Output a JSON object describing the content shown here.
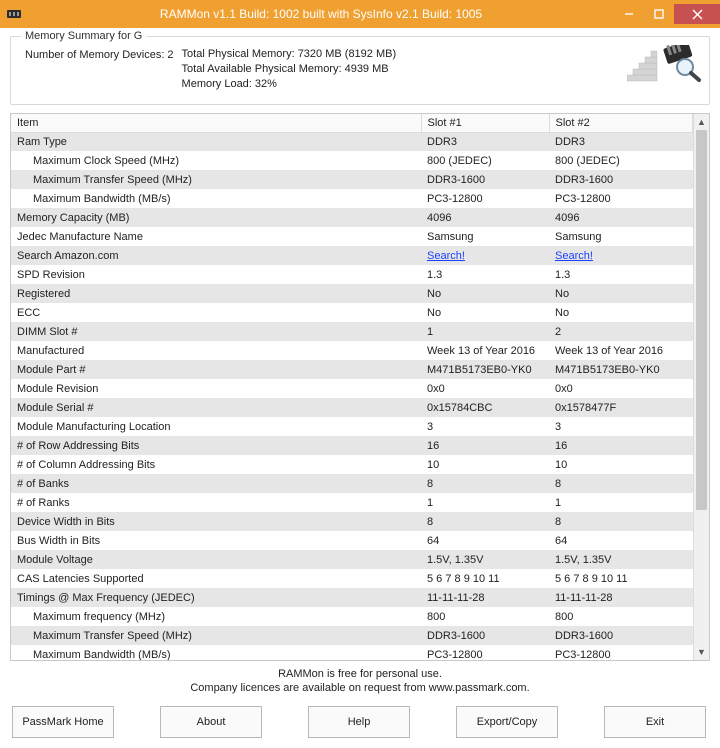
{
  "titlebar": {
    "title": "RAMMon v1.1 Build: 1002 built with SysInfo v2.1 Build: 1005"
  },
  "summary": {
    "legend": "Memory Summary for G",
    "devices_label": "Number of Memory Devices: 2",
    "line1": "Total Physical Memory: 7320 MB (8192 MB)",
    "line2": "Total Available Physical Memory: 4939 MB",
    "line3": "Memory Load: 32%"
  },
  "table": {
    "headers": {
      "c0": "Item",
      "c1": "Slot #1",
      "c2": "Slot #2"
    },
    "rows": [
      {
        "label": "Ram Type",
        "s1": "DDR3",
        "s2": "DDR3",
        "shade": true
      },
      {
        "label": "Maximum Clock Speed (MHz)",
        "s1": "800 (JEDEC)",
        "s2": "800 (JEDEC)",
        "indent": true
      },
      {
        "label": "Maximum Transfer Speed (MHz)",
        "s1": "DDR3-1600",
        "s2": "DDR3-1600",
        "indent": true,
        "shade": true
      },
      {
        "label": "Maximum Bandwidth (MB/s)",
        "s1": "PC3-12800",
        "s2": "PC3-12800",
        "indent": true
      },
      {
        "label": "Memory Capacity (MB)",
        "s1": "4096",
        "s2": "4096",
        "shade": true
      },
      {
        "label": "Jedec Manufacture Name",
        "s1": "Samsung",
        "s2": "Samsung"
      },
      {
        "label": "Search Amazon.com",
        "s1": "Search!",
        "s2": "Search!",
        "shade": true,
        "link": true
      },
      {
        "label": "SPD Revision",
        "s1": "1.3",
        "s2": "1.3"
      },
      {
        "label": "Registered",
        "s1": "No",
        "s2": "No",
        "shade": true
      },
      {
        "label": "ECC",
        "s1": "No",
        "s2": "No"
      },
      {
        "label": "DIMM Slot #",
        "s1": "1",
        "s2": "2",
        "shade": true
      },
      {
        "label": "Manufactured",
        "s1": "Week 13 of Year 2016",
        "s2": "Week 13 of Year 2016"
      },
      {
        "label": "Module Part #",
        "s1": "M471B5173EB0-YK0",
        "s2": "M471B5173EB0-YK0",
        "shade": true
      },
      {
        "label": "Module Revision",
        "s1": "0x0",
        "s2": "0x0"
      },
      {
        "label": "Module Serial #",
        "s1": "0x15784CBC",
        "s2": "0x1578477F",
        "shade": true
      },
      {
        "label": "Module Manufacturing Location",
        "s1": "3",
        "s2": "3"
      },
      {
        "label": "# of Row Addressing Bits",
        "s1": "16",
        "s2": "16",
        "shade": true
      },
      {
        "label": "# of Column Addressing Bits",
        "s1": "10",
        "s2": "10"
      },
      {
        "label": "# of Banks",
        "s1": "8",
        "s2": "8",
        "shade": true
      },
      {
        "label": "# of Ranks",
        "s1": "1",
        "s2": "1"
      },
      {
        "label": "Device Width in Bits",
        "s1": "8",
        "s2": "8",
        "shade": true
      },
      {
        "label": "Bus Width in Bits",
        "s1": "64",
        "s2": "64"
      },
      {
        "label": "Module Voltage",
        "s1": "1.5V, 1.35V",
        "s2": "1.5V, 1.35V",
        "shade": true
      },
      {
        "label": "CAS Latencies Supported",
        "s1": "5 6 7 8 9 10 11",
        "s2": "5 6 7 8 9 10 11"
      },
      {
        "label": "Timings @ Max Frequency (JEDEC)",
        "s1": "11-11-11-28",
        "s2": "11-11-11-28",
        "shade": true
      },
      {
        "label": "Maximum frequency (MHz)",
        "s1": "800",
        "s2": "800",
        "indent": true
      },
      {
        "label": "Maximum Transfer Speed (MHz)",
        "s1": "DDR3-1600",
        "s2": "DDR3-1600",
        "indent": true,
        "shade": true
      },
      {
        "label": "Maximum Bandwidth (MB/s)",
        "s1": "PC3-12800",
        "s2": "PC3-12800",
        "indent": true
      }
    ]
  },
  "footer": {
    "line1": "RAMMon is free for personal use.",
    "line2": "Company licences are available on request from www.passmark.com."
  },
  "buttons": {
    "home": "PassMark Home",
    "about": "About",
    "help": "Help",
    "export": "Export/Copy",
    "exit": "Exit"
  }
}
